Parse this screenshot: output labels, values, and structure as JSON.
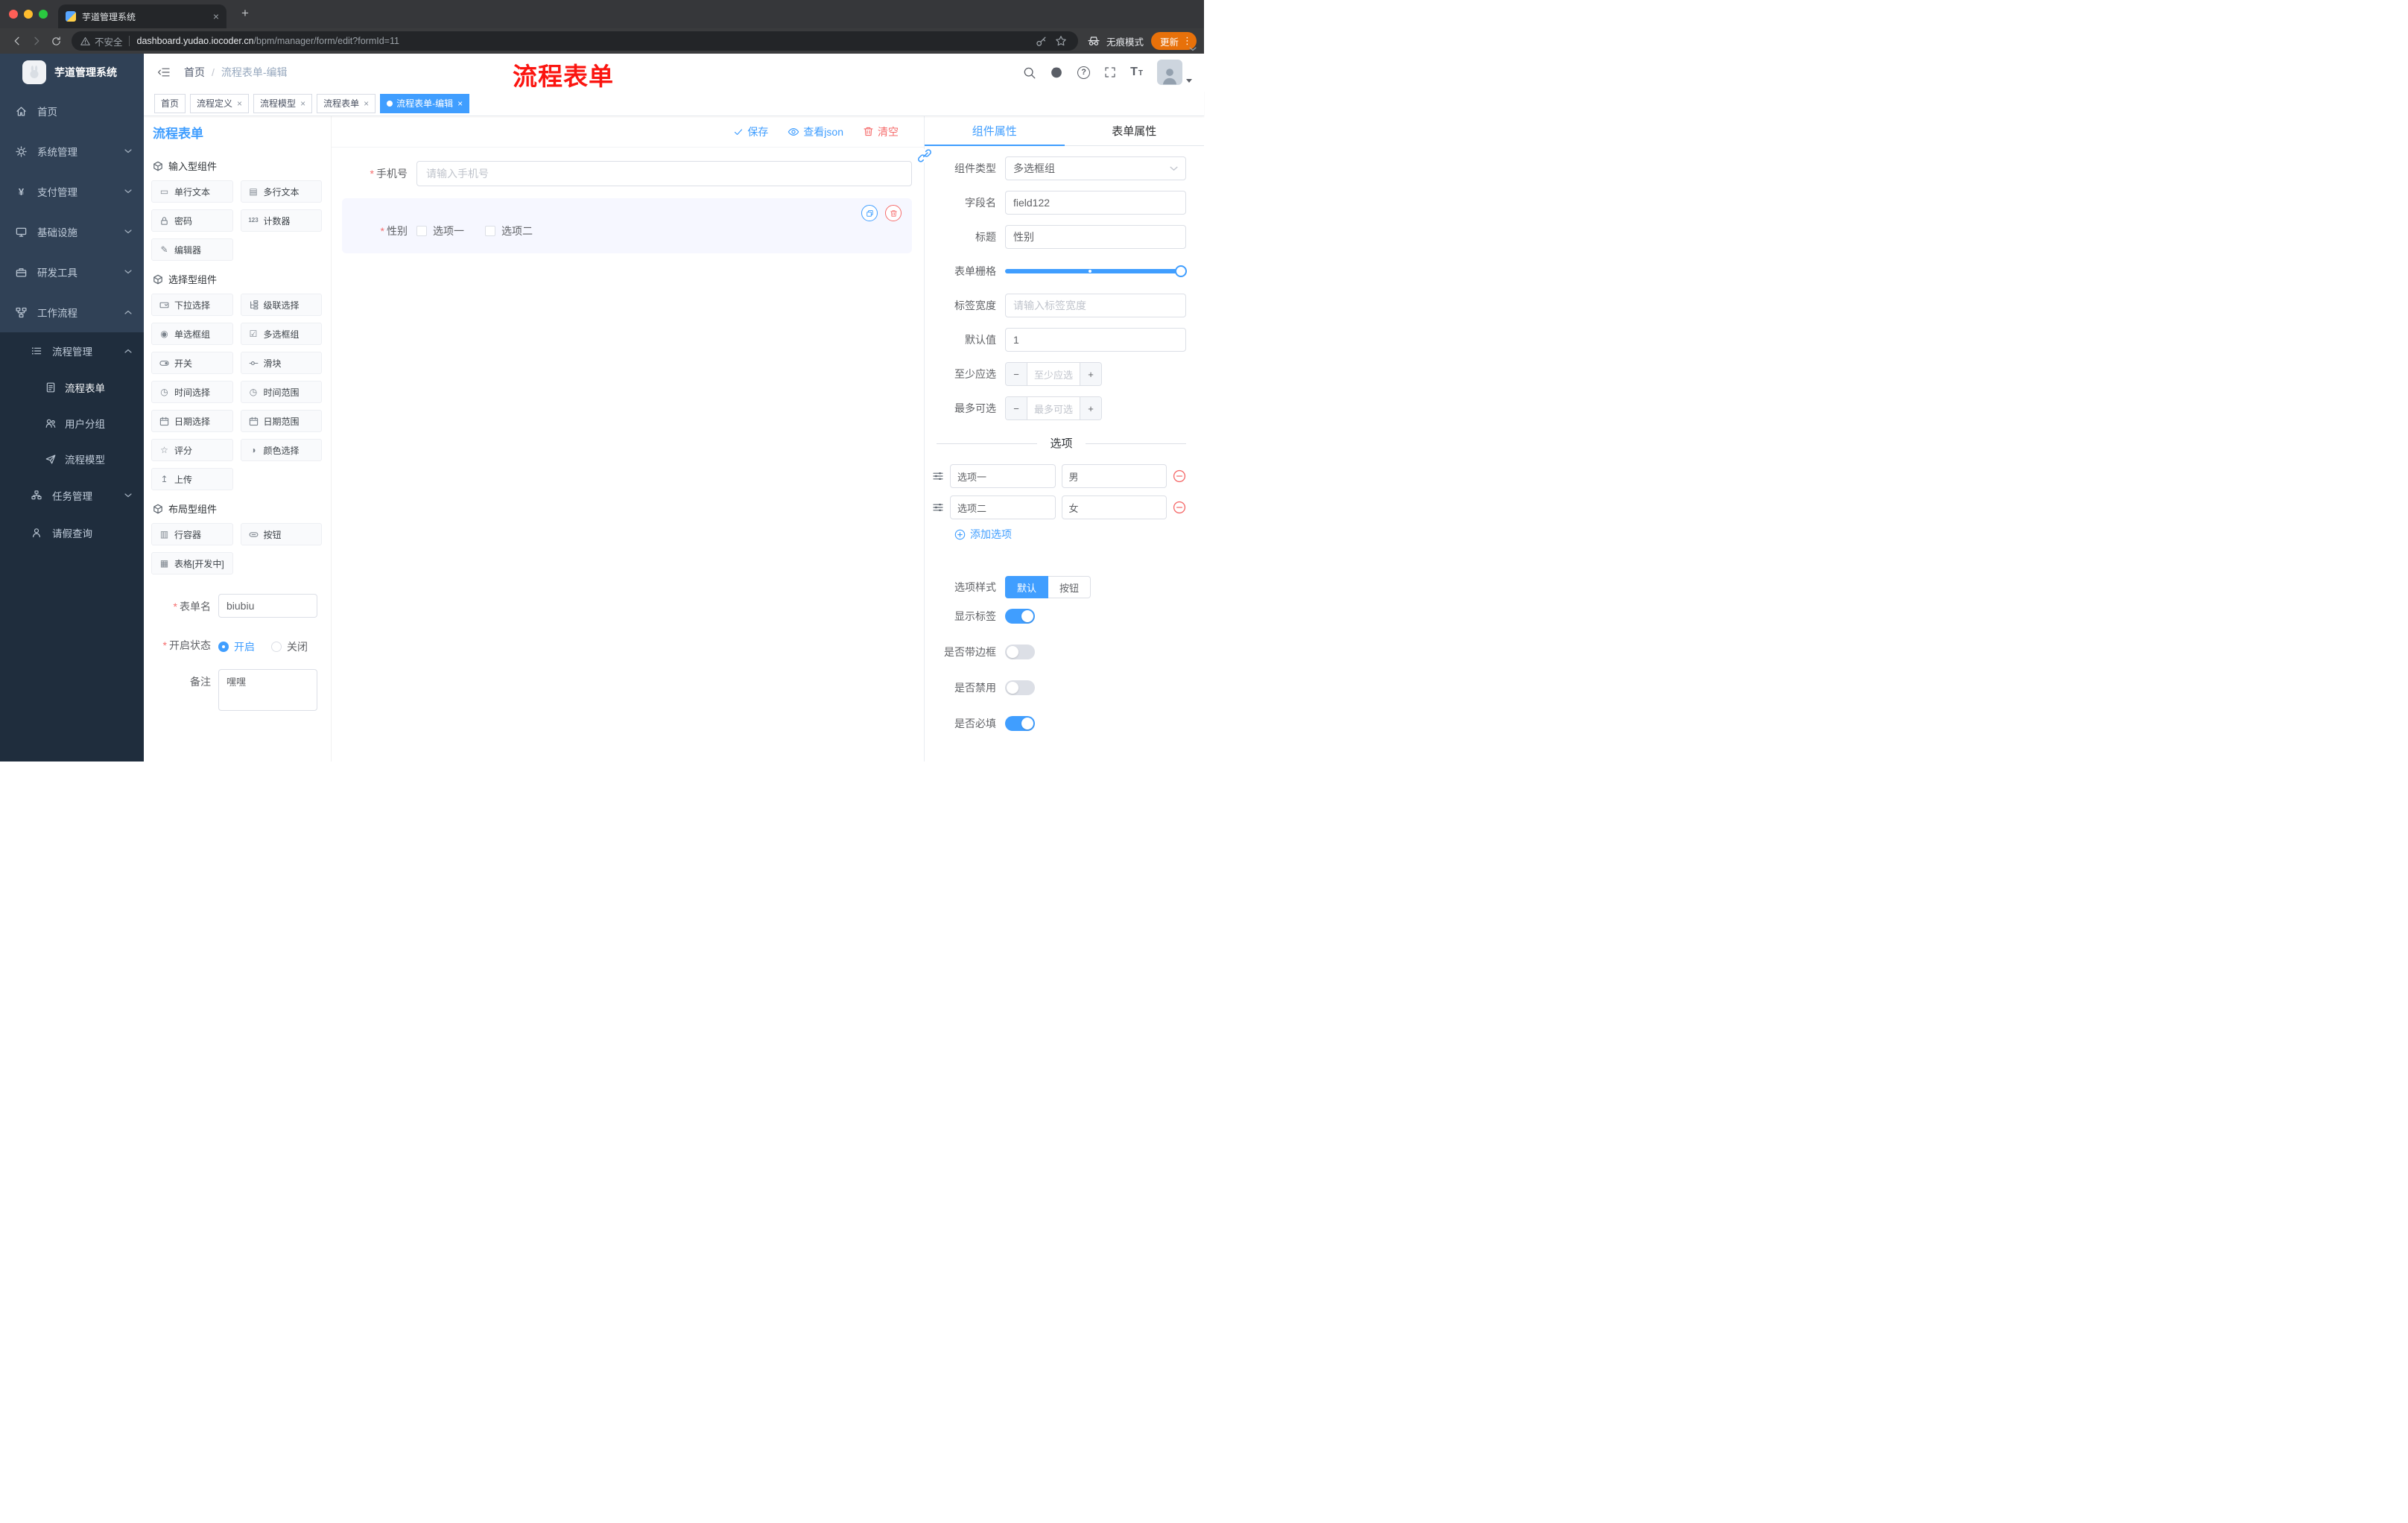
{
  "browser": {
    "tab_title": "芋道管理系统",
    "security_label": "不安全",
    "url_host": "dashboard.yudao.iocoder.cn",
    "url_path": "/bpm/manager/form/edit?formId=11",
    "incognito_label": "无痕模式",
    "update_label": "更新"
  },
  "glyphs": {
    "close": "×",
    "plus": "+",
    "kebab": "⋮",
    "minus": "−",
    "required": "*",
    "slash": "/",
    "question": "?",
    "t_large": "T",
    "t_small": "T"
  },
  "icon_glyphs": {
    "single_line": "▭",
    "multi_line": "▤",
    "counter": "123",
    "editor": "✎",
    "radio_group": "◉",
    "checkbox_group": "☑",
    "time": "◷",
    "time_range": "◷",
    "rate": "☆",
    "color": "◑",
    "upload": "↥",
    "row_container": "▥",
    "table": "▦",
    "payment": "¥"
  },
  "sidebar": {
    "app_title": "芋道管理系统",
    "items": [
      {
        "label": "首页"
      },
      {
        "label": "系统管理"
      },
      {
        "label": "支付管理"
      },
      {
        "label": "基础设施"
      },
      {
        "label": "研发工具"
      },
      {
        "label": "工作流程"
      },
      {
        "label": "流程管理"
      },
      {
        "label": "流程表单"
      },
      {
        "label": "用户分组"
      },
      {
        "label": "流程模型"
      },
      {
        "label": "任务管理"
      },
      {
        "label": "请假查询"
      }
    ]
  },
  "header": {
    "breadcrumb": [
      "首页",
      "流程表单-编辑"
    ]
  },
  "annotation": "流程表单",
  "tags": [
    {
      "label": "首页"
    },
    {
      "label": "流程定义"
    },
    {
      "label": "流程模型"
    },
    {
      "label": "流程表单"
    },
    {
      "label": "流程表单-编辑"
    }
  ],
  "designer": {
    "title": "流程表单",
    "actions": {
      "save": "保存",
      "view_json": "查看json",
      "clear": "清空"
    },
    "groups": [
      {
        "title": "输入型组件",
        "items": [
          "单行文本",
          "多行文本",
          "密码",
          "计数器",
          "编辑器"
        ]
      },
      {
        "title": "选择型组件",
        "items": [
          "下拉选择",
          "级联选择",
          "单选框组",
          "多选框组",
          "开关",
          "滑块",
          "时间选择",
          "时间范围",
          "日期选择",
          "日期范围",
          "评分",
          "颜色选择",
          "上传"
        ]
      },
      {
        "title": "布局型组件",
        "items": [
          "行容器",
          "按钮",
          "表格[开发中]"
        ]
      }
    ],
    "form_meta": {
      "name_label": "表单名",
      "name_value": "biubiu",
      "status_label": "开启状态",
      "status_on": "开启",
      "status_off": "关闭",
      "remark_label": "备注",
      "remark_value": "嘿嘿"
    }
  },
  "canvas": {
    "phone_label": "手机号",
    "phone_placeholder": "请输入手机号",
    "gender_label": "性别",
    "gender_options": [
      "选项一",
      "选项二"
    ]
  },
  "props": {
    "tabs": [
      "组件属性",
      "表单属性"
    ],
    "component_type_label": "组件类型",
    "component_type_value": "多选框组",
    "field_name_label": "字段名",
    "field_name_value": "field122",
    "title_label": "标题",
    "title_value": "性别",
    "grid_label": "表单栅格",
    "label_width_label": "标签宽度",
    "label_width_placeholder": "请输入标签宽度",
    "default_label": "默认值",
    "default_value": "1",
    "min_label": "至少应选",
    "min_placeholder": "至少应选",
    "max_label": "最多可选",
    "max_placeholder": "最多可选",
    "options_divider": "选项",
    "options": [
      {
        "label": "选项一",
        "value": "男"
      },
      {
        "label": "选项二",
        "value": "女"
      }
    ],
    "add_option": "添加选项",
    "style_label": "选项样式",
    "style_options": [
      "默认",
      "按钮"
    ],
    "toggles": [
      {
        "label": "显示标签",
        "on": true
      },
      {
        "label": "是否带边框",
        "on": false
      },
      {
        "label": "是否禁用",
        "on": false
      },
      {
        "label": "是否必填",
        "on": true
      }
    ]
  },
  "colors": {
    "accent": "#409EFF",
    "danger": "#F56C6C",
    "annotation": "#FB1510",
    "update_badge": "#E8710A",
    "sidebar_bg": "#304156",
    "sidebar_submenu_bg": "#1F2D3D",
    "selected_component_bg": "#F6F7FF"
  }
}
